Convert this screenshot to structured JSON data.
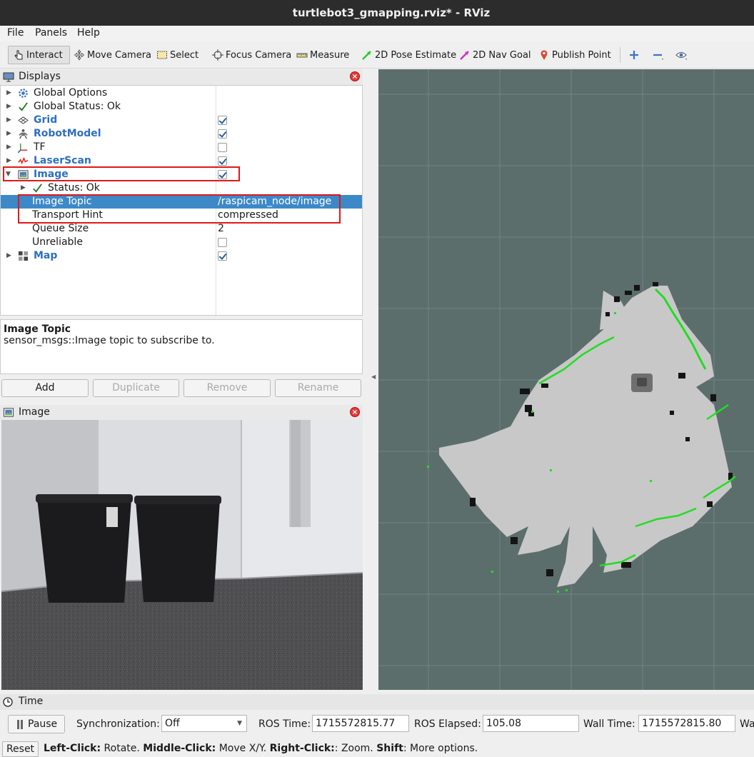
{
  "window": {
    "title": "turtlebot3_gmapping.rviz* - RViz"
  },
  "menu": [
    "File",
    "Panels",
    "Help"
  ],
  "toolbar": {
    "interact": "Interact",
    "move_camera": "Move Camera",
    "select": "Select",
    "focus_camera": "Focus Camera",
    "measure": "Measure",
    "pose_estimate": "2D Pose Estimate",
    "nav_goal": "2D Nav Goal",
    "publish_point": "Publish Point"
  },
  "displays": {
    "title": "Displays",
    "rows": [
      {
        "label": "Global Options"
      },
      {
        "label": "Global Status: Ok"
      },
      {
        "label": "Grid",
        "checked": true
      },
      {
        "label": "RobotModel",
        "checked": true
      },
      {
        "label": "TF",
        "checked": false
      },
      {
        "label": "LaserScan",
        "checked": true
      },
      {
        "label": "Image",
        "checked": true
      },
      {
        "label": "Status: Ok"
      },
      {
        "label": "Image Topic",
        "value": "/raspicam_node/image"
      },
      {
        "label": "Transport Hint",
        "value": "compressed"
      },
      {
        "label": "Queue Size",
        "value": "2"
      },
      {
        "label": "Unreliable",
        "checked": false
      },
      {
        "label": "Map",
        "checked": true
      }
    ]
  },
  "description": {
    "title": "Image Topic",
    "text": "sensor_msgs::Image topic to subscribe to."
  },
  "buttons": {
    "add": "Add",
    "duplicate": "Duplicate",
    "remove": "Remove",
    "rename": "Rename"
  },
  "image_panel": {
    "title": "Image"
  },
  "time": {
    "title": "Time",
    "pause": "Pause",
    "sync_label": "Synchronization:",
    "sync_value": "Off",
    "ros_time_label": "ROS Time:",
    "ros_time": "1715572815.77",
    "ros_elapsed_label": "ROS Elapsed:",
    "ros_elapsed": "105.08",
    "wall_time_label": "Wall Time:",
    "wall_time": "1715572815.80",
    "wall_elapsed_label": "Wa"
  },
  "status": {
    "reset": "Reset",
    "k1": "Left-Click:",
    "v1": " Rotate. ",
    "k2": "Middle-Click:",
    "v2": " Move X/Y. ",
    "k3": "Right-Click:",
    "v3": ": Zoom. ",
    "k4": "Shift",
    "v4": ": More options."
  },
  "colors": {
    "accent": "#3d89c8",
    "highlight_box": "#e01818",
    "view_bg": "#5b6e6c",
    "laser": "#22dd22"
  }
}
